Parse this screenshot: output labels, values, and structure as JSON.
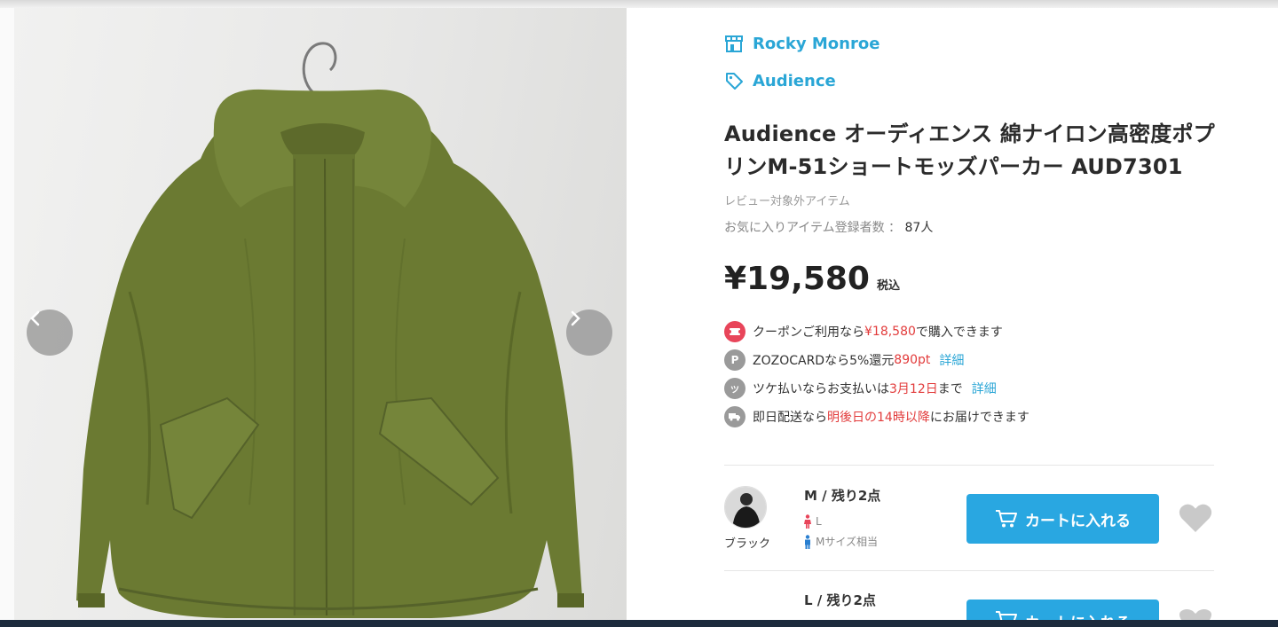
{
  "shop": {
    "brand": "Rocky Monroe",
    "tag": "Audience"
  },
  "product": {
    "title": "Audience オーディエンス 綿ナイロン高密度ポプリンM-51ショートモッズパーカー AUD7301",
    "review_note": "レビュー対象外アイテム",
    "favorites_label": "お気に入りアイテム登録者数 ：",
    "favorites_count": "87人",
    "price": "¥19,580",
    "tax_label": "税込"
  },
  "perks": {
    "coupon": {
      "text_before": "クーポンご利用なら",
      "amount": "¥18,580",
      "text_after": "で購入できます"
    },
    "card": {
      "text_before": "ZOZOCARDなら5%還元",
      "points": "890pt",
      "link": "詳細"
    },
    "tsuke": {
      "text_before": "ツケ払いならお支払いは",
      "date": "3月12日",
      "text_after": "まで",
      "link": "詳細"
    },
    "delivery": {
      "text_before": "即日配送なら",
      "time": "明後日の14時以降",
      "text_after": "にお届けできます"
    }
  },
  "variants": {
    "color_label": "ブラック",
    "m": {
      "title": "M / 残り2点",
      "female_fit": "L",
      "male_fit": "Mサイズ相当",
      "cart_label": "カートに入れる"
    },
    "l": {
      "title": "L / 残り2点",
      "cart_label": "カートに入れる"
    }
  },
  "icons": {
    "brand": "shop-icon",
    "tag": "tag-icon",
    "coupon": "coupon-icon",
    "card": "points-icon",
    "tsuke": "tsuke-icon",
    "delivery": "truck-icon",
    "cart": "cart-icon",
    "favorite": "heart-icon",
    "prev": "chevron-left-icon",
    "next": "chevron-right-icon"
  },
  "colors": {
    "accent": "#29a7e1",
    "link": "#2aa6d6",
    "highlight": "#e23b3b",
    "jacket": "#6b7a32"
  }
}
